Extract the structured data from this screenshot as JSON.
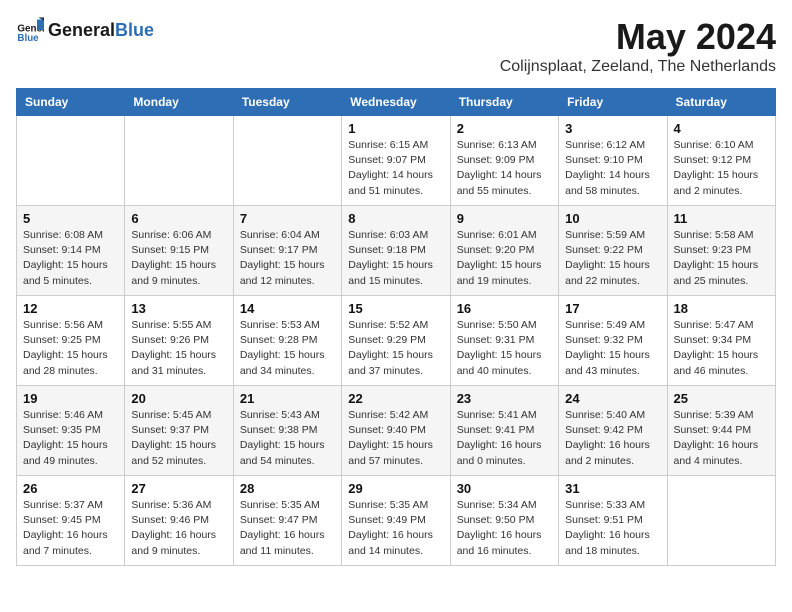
{
  "header": {
    "logo_general": "General",
    "logo_blue": "Blue",
    "title": "May 2024",
    "location": "Colijnsplaat, Zeeland, The Netherlands"
  },
  "weekdays": [
    "Sunday",
    "Monday",
    "Tuesday",
    "Wednesday",
    "Thursday",
    "Friday",
    "Saturday"
  ],
  "weeks": [
    [
      {
        "day": "",
        "detail": ""
      },
      {
        "day": "",
        "detail": ""
      },
      {
        "day": "",
        "detail": ""
      },
      {
        "day": "1",
        "detail": "Sunrise: 6:15 AM\nSunset: 9:07 PM\nDaylight: 14 hours\nand 51 minutes."
      },
      {
        "day": "2",
        "detail": "Sunrise: 6:13 AM\nSunset: 9:09 PM\nDaylight: 14 hours\nand 55 minutes."
      },
      {
        "day": "3",
        "detail": "Sunrise: 6:12 AM\nSunset: 9:10 PM\nDaylight: 14 hours\nand 58 minutes."
      },
      {
        "day": "4",
        "detail": "Sunrise: 6:10 AM\nSunset: 9:12 PM\nDaylight: 15 hours\nand 2 minutes."
      }
    ],
    [
      {
        "day": "5",
        "detail": "Sunrise: 6:08 AM\nSunset: 9:14 PM\nDaylight: 15 hours\nand 5 minutes."
      },
      {
        "day": "6",
        "detail": "Sunrise: 6:06 AM\nSunset: 9:15 PM\nDaylight: 15 hours\nand 9 minutes."
      },
      {
        "day": "7",
        "detail": "Sunrise: 6:04 AM\nSunset: 9:17 PM\nDaylight: 15 hours\nand 12 minutes."
      },
      {
        "day": "8",
        "detail": "Sunrise: 6:03 AM\nSunset: 9:18 PM\nDaylight: 15 hours\nand 15 minutes."
      },
      {
        "day": "9",
        "detail": "Sunrise: 6:01 AM\nSunset: 9:20 PM\nDaylight: 15 hours\nand 19 minutes."
      },
      {
        "day": "10",
        "detail": "Sunrise: 5:59 AM\nSunset: 9:22 PM\nDaylight: 15 hours\nand 22 minutes."
      },
      {
        "day": "11",
        "detail": "Sunrise: 5:58 AM\nSunset: 9:23 PM\nDaylight: 15 hours\nand 25 minutes."
      }
    ],
    [
      {
        "day": "12",
        "detail": "Sunrise: 5:56 AM\nSunset: 9:25 PM\nDaylight: 15 hours\nand 28 minutes."
      },
      {
        "day": "13",
        "detail": "Sunrise: 5:55 AM\nSunset: 9:26 PM\nDaylight: 15 hours\nand 31 minutes."
      },
      {
        "day": "14",
        "detail": "Sunrise: 5:53 AM\nSunset: 9:28 PM\nDaylight: 15 hours\nand 34 minutes."
      },
      {
        "day": "15",
        "detail": "Sunrise: 5:52 AM\nSunset: 9:29 PM\nDaylight: 15 hours\nand 37 minutes."
      },
      {
        "day": "16",
        "detail": "Sunrise: 5:50 AM\nSunset: 9:31 PM\nDaylight: 15 hours\nand 40 minutes."
      },
      {
        "day": "17",
        "detail": "Sunrise: 5:49 AM\nSunset: 9:32 PM\nDaylight: 15 hours\nand 43 minutes."
      },
      {
        "day": "18",
        "detail": "Sunrise: 5:47 AM\nSunset: 9:34 PM\nDaylight: 15 hours\nand 46 minutes."
      }
    ],
    [
      {
        "day": "19",
        "detail": "Sunrise: 5:46 AM\nSunset: 9:35 PM\nDaylight: 15 hours\nand 49 minutes."
      },
      {
        "day": "20",
        "detail": "Sunrise: 5:45 AM\nSunset: 9:37 PM\nDaylight: 15 hours\nand 52 minutes."
      },
      {
        "day": "21",
        "detail": "Sunrise: 5:43 AM\nSunset: 9:38 PM\nDaylight: 15 hours\nand 54 minutes."
      },
      {
        "day": "22",
        "detail": "Sunrise: 5:42 AM\nSunset: 9:40 PM\nDaylight: 15 hours\nand 57 minutes."
      },
      {
        "day": "23",
        "detail": "Sunrise: 5:41 AM\nSunset: 9:41 PM\nDaylight: 16 hours\nand 0 minutes."
      },
      {
        "day": "24",
        "detail": "Sunrise: 5:40 AM\nSunset: 9:42 PM\nDaylight: 16 hours\nand 2 minutes."
      },
      {
        "day": "25",
        "detail": "Sunrise: 5:39 AM\nSunset: 9:44 PM\nDaylight: 16 hours\nand 4 minutes."
      }
    ],
    [
      {
        "day": "26",
        "detail": "Sunrise: 5:37 AM\nSunset: 9:45 PM\nDaylight: 16 hours\nand 7 minutes."
      },
      {
        "day": "27",
        "detail": "Sunrise: 5:36 AM\nSunset: 9:46 PM\nDaylight: 16 hours\nand 9 minutes."
      },
      {
        "day": "28",
        "detail": "Sunrise: 5:35 AM\nSunset: 9:47 PM\nDaylight: 16 hours\nand 11 minutes."
      },
      {
        "day": "29",
        "detail": "Sunrise: 5:35 AM\nSunset: 9:49 PM\nDaylight: 16 hours\nand 14 minutes."
      },
      {
        "day": "30",
        "detail": "Sunrise: 5:34 AM\nSunset: 9:50 PM\nDaylight: 16 hours\nand 16 minutes."
      },
      {
        "day": "31",
        "detail": "Sunrise: 5:33 AM\nSunset: 9:51 PM\nDaylight: 16 hours\nand 18 minutes."
      },
      {
        "day": "",
        "detail": ""
      }
    ]
  ]
}
